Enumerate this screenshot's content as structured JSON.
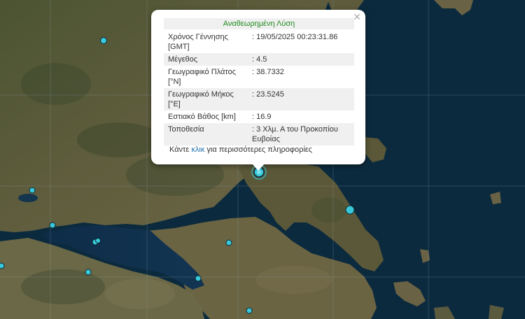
{
  "popup": {
    "title": "Αναθεωρημένη Λύση",
    "close_icon": "close-icon",
    "rows": [
      {
        "label": "Χρόνος Γέννησης [GMT]",
        "value": ": 19/05/2025 00:23:31.86"
      },
      {
        "label": "Μέγεθος",
        "value": ": 4.5"
      },
      {
        "label": "Γεωγραφικό Πλάτος [°N]",
        "value": ": 38.7332"
      },
      {
        "label": "Γεωγραφικό Μήκος [°E]",
        "value": ": 23.5245"
      },
      {
        "label": "Εστιακό Βάθος [km]",
        "value": ": 16.9"
      },
      {
        "label": "Τοποθεσία",
        "value": ": 3 Χλμ. Α του Προκοπίου Ευβοίας"
      }
    ],
    "more_prefix": "Κάντε ",
    "more_link": "κλικ",
    "more_suffix": " για περισσότερες πληροφορίες"
  },
  "colors": {
    "sea": "#0c2a3e",
    "land_dark": "#3a4a2c",
    "land_mid": "#5a5e3c",
    "land_light": "#7c7350",
    "quake_marker": "#39c8d8",
    "popup_title": "#1f8a1f",
    "link": "#1f6fb2"
  }
}
